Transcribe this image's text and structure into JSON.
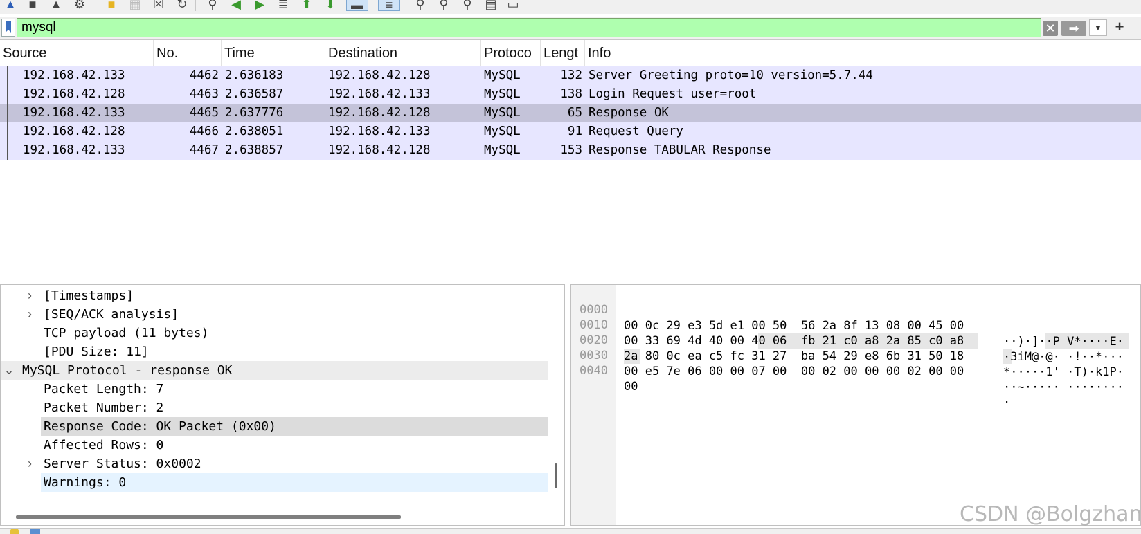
{
  "toolbar": {
    "icons": [
      "shark-fin-start-icon",
      "stop-capture-icon",
      "restart-capture-icon",
      "capture-options-icon",
      "open-file-icon",
      "save-file-icon",
      "close-file-icon",
      "reload-file-icon",
      "find-packet-icon",
      "go-back-icon",
      "go-forward-icon",
      "go-to-packet-icon",
      "first-packet-icon",
      "last-packet-icon",
      "auto-scroll-icon",
      "colorize-icon",
      "zoom-in-icon",
      "zoom-out-icon",
      "normal-size-icon",
      "resize-columns-icon",
      "columns-icon"
    ]
  },
  "filter": {
    "value": "mysql",
    "bg_color": "#afffaf",
    "clear_icon": "close-x-icon",
    "apply_icon": "arrow-right-icon",
    "add_icon": "plus-icon"
  },
  "packet_list": {
    "columns": [
      "Source",
      "No.",
      "Time",
      "Destination",
      "Protoco",
      "Lengt",
      "Info"
    ],
    "rows": [
      {
        "source": "192.168.42.133",
        "no": "4462",
        "time": "2.636183",
        "destination": "192.168.42.128",
        "protocol": "MySQL",
        "length": "132",
        "info": "Server Greeting  proto=10 version=5.7.44",
        "selected": false
      },
      {
        "source": "192.168.42.128",
        "no": "4463",
        "time": "2.636587",
        "destination": "192.168.42.133",
        "protocol": "MySQL",
        "length": "138",
        "info": "Login Request user=root",
        "selected": false
      },
      {
        "source": "192.168.42.133",
        "no": "4465",
        "time": "2.637776",
        "destination": "192.168.42.128",
        "protocol": "MySQL",
        "length": "65",
        "info": "Response  OK",
        "selected": true
      },
      {
        "source": "192.168.42.128",
        "no": "4466",
        "time": "2.638051",
        "destination": "192.168.42.133",
        "protocol": "MySQL",
        "length": "91",
        "info": "Request Query",
        "selected": false
      },
      {
        "source": "192.168.42.133",
        "no": "4467",
        "time": "2.638857",
        "destination": "192.168.42.128",
        "protocol": "MySQL",
        "length": "153",
        "info": "Response TABULAR Response",
        "selected": false
      }
    ],
    "row_color": "#e7e6ff",
    "selected_row_color": "#c4c3d9"
  },
  "details": {
    "items": [
      {
        "text": "[Timestamps]",
        "expander": "collapsed",
        "level": 1
      },
      {
        "text": "[SEQ/ACK analysis]",
        "expander": "collapsed",
        "level": 1
      },
      {
        "text": "TCP payload (11 bytes)",
        "expander": "none",
        "level": 1
      },
      {
        "text": "[PDU Size: 11]",
        "expander": "none",
        "level": 1
      },
      {
        "text": "MySQL Protocol - response OK",
        "expander": "expanded",
        "level": 0
      },
      {
        "text": "Packet Length: 7",
        "expander": "none",
        "level": 1
      },
      {
        "text": "Packet Number: 2",
        "expander": "none",
        "level": 1
      },
      {
        "text": "Response Code: OK Packet (0x00)",
        "expander": "none",
        "level": 1
      },
      {
        "text": "Affected Rows: 0",
        "expander": "none",
        "level": 1
      },
      {
        "text": "Server Status: 0x0002",
        "expander": "collapsed",
        "level": 1
      },
      {
        "text": "Warnings: 0",
        "expander": "none",
        "level": 1
      }
    ]
  },
  "bytes": {
    "rows": [
      {
        "offset": "0000",
        "hex": "00 0c 29 e3 5d e1 00 50  56 2a 8f 13 08 00 45 00",
        "ascii": "··)·]··P V*····E·"
      },
      {
        "offset": "0010",
        "hex": "00 33 69 4d 40 00 40 06  fb 21 c0 a8 2a 85 c0 a8",
        "ascii": "·3iM@·@· ·!··*···"
      },
      {
        "offset": "0020",
        "hex": "2a 80 0c ea c5 fc 31 27  ba 54 29 e8 6b 31 50 18",
        "ascii": "*·····1' ·T)·k1P·"
      },
      {
        "offset": "0030",
        "hex": "00 e5 7e 06 00 00 07 00  00 02 00 00 00 02 00 00",
        "ascii": "··~····· ········"
      },
      {
        "offset": "0040",
        "hex": "00",
        "ascii": "·"
      }
    ]
  },
  "watermark": "CSDN @Bolgzhang"
}
